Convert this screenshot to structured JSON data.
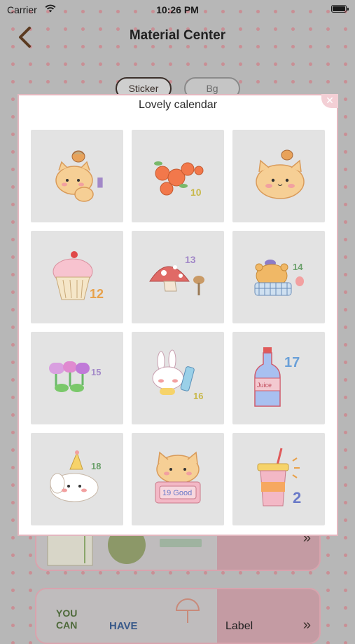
{
  "status_bar": {
    "carrier": "Carrier",
    "time": "10:26 PM"
  },
  "header": {
    "title": "Material Center"
  },
  "tabs": [
    {
      "label": "Sticker",
      "selected": true
    },
    {
      "label": "Bg",
      "selected": false
    }
  ],
  "background_cards": [
    {
      "label": ""
    },
    {
      "label": "Label"
    }
  ],
  "background_card_art": {
    "text_line1": "YOU",
    "text_line2": "CAN",
    "text_line3": "HAVE"
  },
  "modal": {
    "title": "Lovely calendar",
    "close_icon": "close-icon",
    "stickers": [
      {
        "icon": "cat-with-acorn-sticker",
        "label": "1"
      },
      {
        "icon": "oranges-sticker",
        "label": "10"
      },
      {
        "icon": "cat-face-sticker",
        "label": ""
      },
      {
        "icon": "cupcake-sticker",
        "label": "12"
      },
      {
        "icon": "mushroom-sticker",
        "label": "13"
      },
      {
        "icon": "bear-in-basket-sticker",
        "label": "14"
      },
      {
        "icon": "flowers-sticker",
        "label": "15"
      },
      {
        "icon": "bunny-with-drink-sticker",
        "label": "16"
      },
      {
        "icon": "juice-bottle-sticker",
        "label": "17",
        "text": "Juice"
      },
      {
        "icon": "puppy-party-hat-sticker",
        "label": "18"
      },
      {
        "icon": "cat-with-sign-sticker",
        "label": "19",
        "text": "19 Good"
      },
      {
        "icon": "drink-cup-sticker",
        "label": "2"
      }
    ]
  },
  "colors": {
    "dot": "#c98f95",
    "modal_border": "#e3b7bf",
    "cell_bg": "#e3e3e3"
  }
}
